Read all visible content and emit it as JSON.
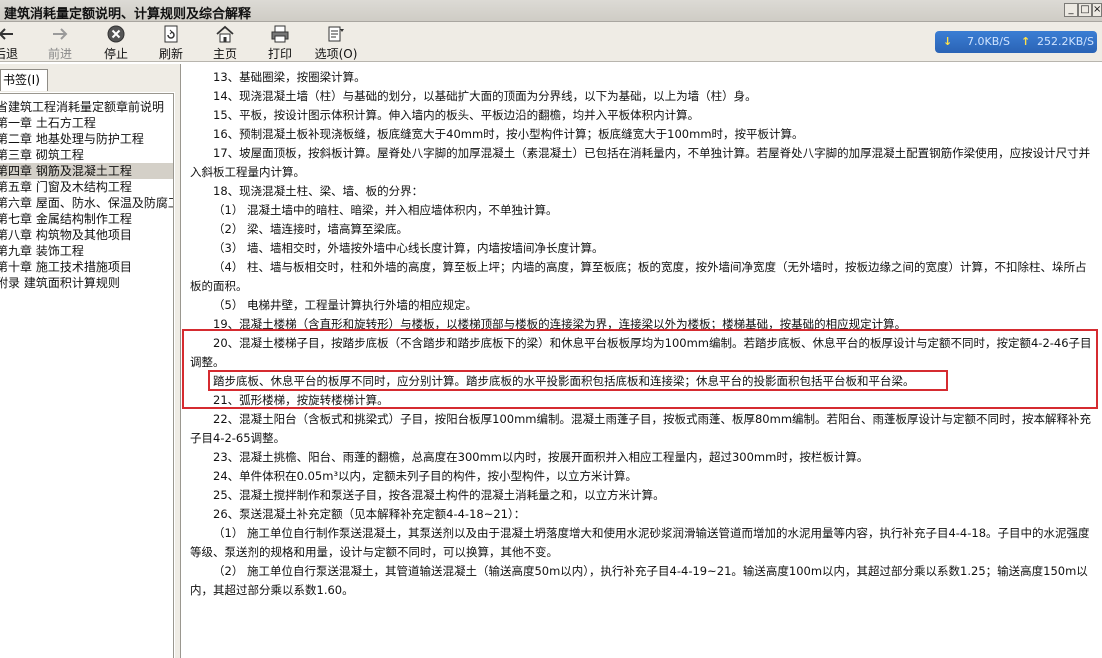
{
  "window": {
    "title": "建筑消耗量定额说明、计算规则及综合解释",
    "controls": [
      "_",
      "□",
      "×"
    ]
  },
  "toolbar": {
    "back": "后退",
    "forward": "前进",
    "stop": "停止",
    "refresh": "刷新",
    "home": "主页",
    "print": "打印",
    "options": "选项(O)"
  },
  "network": {
    "down_arrow": "↓",
    "down_speed": "7.0KB/S",
    "up_arrow": "↑",
    "up_speed": "252.2KB/S"
  },
  "sidebar": {
    "tab_label": "书签(I)",
    "items": [
      {
        "label": "省建筑工程消耗量定额章前说明",
        "selected": false
      },
      {
        "label": "第一章 土石方工程",
        "selected": false
      },
      {
        "label": "第二章 地基处理与防护工程",
        "selected": false
      },
      {
        "label": "第三章 砌筑工程",
        "selected": false
      },
      {
        "label": "第四章 钢筋及混凝土工程",
        "selected": true
      },
      {
        "label": "第五章 门窗及木结构工程",
        "selected": false
      },
      {
        "label": "第六章 屋面、防水、保温及防腐工程",
        "selected": false
      },
      {
        "label": "第七章 金属结构制作工程",
        "selected": false
      },
      {
        "label": "第八章 构筑物及其他项目",
        "selected": false
      },
      {
        "label": "第九章 装饰工程",
        "selected": false
      },
      {
        "label": "第十章 施工技术措施项目",
        "selected": false
      },
      {
        "label": "附录 建筑面积计算规则",
        "selected": false
      }
    ]
  },
  "content": {
    "paragraphs": [
      "13、基础圈梁，按圈梁计算。",
      "14、现浇混凝土墙（柱）与基础的划分，以基础扩大面的顶面为分界线，以下为基础，以上为墙（柱）身。",
      "15、平板，按设计图示体积计算。伸入墙内的板头、平板边沿的翻檐，均并入平板体积内计算。",
      "16、预制混凝土板补现浇板缝，板底缝宽大于40mm时，按小型构件计算；板底缝宽大于100mm时，按平板计算。",
      "17、坡屋面顶板，按斜板计算。屋脊处八字脚的加厚混凝土（素混凝土）已包括在消耗量内，不单独计算。若屋脊处八字脚的加厚混凝土配置钢筋作梁使用，应按设计尺寸并入斜板工程量内计算。",
      "18、现浇混凝土柱、梁、墙、板的分界：",
      "（1） 混凝土墙中的暗柱、暗梁，并入相应墙体积内，不单独计算。",
      "（2） 梁、墙连接时，墙高算至梁底。",
      "（3） 墙、墙相交时，外墙按外墙中心线长度计算，内墙按墙间净长度计算。",
      "（4） 柱、墙与板相交时，柱和外墙的高度，算至板上坪；内墙的高度，算至板底；板的宽度，按外墙间净宽度（无外墙时，按板边缘之间的宽度）计算，不扣除柱、垛所占板的面积。",
      "（5） 电梯井壁，工程量计算执行外墙的相应规定。",
      "19、混凝土楼梯（含直形和旋转形）与楼板，以楼梯顶部与楼板的连接梁为界，连接梁以外为楼板；楼梯基础，按基础的相应规定计算。",
      "20、混凝土楼梯子目，按踏步底板（不含踏步和踏步底板下的梁）和休息平台板板厚均为100mm编制。若踏步底板、休息平台的板厚设计与定额不同时，按定额4-2-46子目调整。",
      "踏步底板、休息平台的板厚不同时，应分别计算。踏步底板的水平投影面积包括底板和连接梁；休息平台的投影面积包括平台板和平台梁。",
      "21、弧形楼梯，按旋转楼梯计算。",
      "22、混凝土阳台（含板式和挑梁式）子目，按阳台板厚100mm编制。混凝土雨蓬子目，按板式雨蓬、板厚80mm编制。若阳台、雨蓬板厚设计与定额不同时，按本解释补充子目4-2-65调整。",
      "23、混凝土挑檐、阳台、雨蓬的翻檐，总高度在300mm以内时，按展开面积并入相应工程量内，超过300mm时，按栏板计算。",
      "24、单件体积在0.05m³以内，定额未列子目的构件，按小型构件，以立方米计算。",
      "25、混凝土搅拌制作和泵送子目，按各混凝土构件的混凝土消耗量之和，以立方米计算。",
      "26、泵送混凝土补充定额（见本解释补充定额4-4-18~21）：",
      "（1） 施工单位自行制作泵送混凝土，其泵送剂以及由于混凝土坍落度增大和使用水泥砂浆润滑输送管道而增加的水泥用量等内容，执行补充子目4-4-18。子目中的水泥强度等级、泵送剂的规格和用量，设计与定额不同时，可以换算，其他不变。",
      "（2） 施工单位自行泵送混凝土，其管道输送混凝土（输送高度50m以内），执行补充子目4-4-19~21。输送高度100m以内，其超过部分乘以系数1.25；输送高度150m以内，其超过部分乘以系数1.60。"
    ]
  },
  "colors": {
    "highlight": "#d52b30",
    "selection": "#d4d0c8",
    "network_bg": "#2a63b5"
  }
}
